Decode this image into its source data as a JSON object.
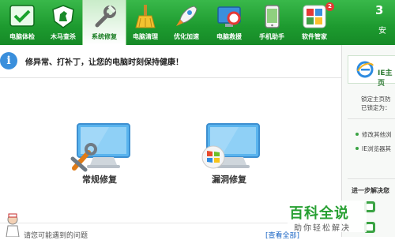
{
  "toolbar": {
    "items": [
      {
        "label": "电脑体检"
      },
      {
        "label": "木马查杀"
      },
      {
        "label": "系统修复"
      },
      {
        "label": "电脑清理"
      },
      {
        "label": "优化加速"
      },
      {
        "label": "电脑救援"
      },
      {
        "label": "手机助手"
      },
      {
        "label": "软件管家"
      }
    ],
    "software_badge": "2",
    "brand_top": "3",
    "brand_bottom": "安"
  },
  "info": {
    "message": "修异常、打补丁，让您的电脑时刻保持健康！"
  },
  "main": {
    "regular_fix_label": "常规修复",
    "vuln_fix_label": "漏洞修复"
  },
  "bottom": {
    "hint": "请您可能遇到的问题",
    "link": "[查看全部]"
  },
  "right_panel": {
    "ie_title": "IE主页",
    "lock_line1": "锁定主页防",
    "lock_line2": "已锁定为：",
    "item1": "修改其他浏",
    "item2": "IE浏览器其",
    "more_solutions": "进一步解决您"
  },
  "watermark": {
    "title": "百科全说",
    "subtitle": "助你轻松解决"
  },
  "colors": {
    "toolbar_green": "#1d9a2f",
    "info_blue": "#3a8fdc",
    "link_blue": "#1a65c4"
  }
}
